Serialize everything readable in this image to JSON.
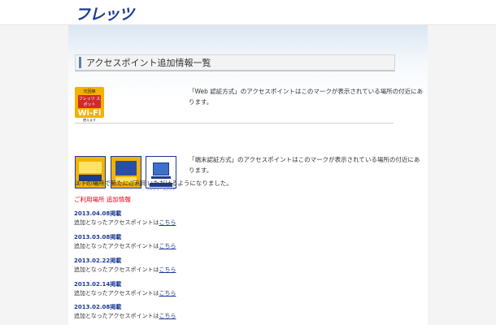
{
  "header": {
    "logo_text": "フレッツ"
  },
  "section": {
    "title": "アクセスポイント追加情報一覧"
  },
  "badges": {
    "wifi": {
      "top": "光回線",
      "mid": "フレッツ スポット",
      "big": "Wi-Fi",
      "sub": "使えます"
    },
    "marks": [
      {
        "label": "フレッツ・スポット",
        "icon": "network-sticker-icon"
      },
      {
        "label": "フレッツ・スポット",
        "icon": "laptop-sticker-icon"
      },
      {
        "label": "フレッツ・スポット",
        "icon": "pc-sticker-icon"
      }
    ]
  },
  "descriptions": {
    "web_auth": "「Web 認証方式」のアクセスポイントはこのマークが表示されている場所の付近にあります。",
    "device_auth": "「端末認証方式」のアクセスポイントはこのマークが表示されている場所の付近にあります。"
  },
  "intro": "以下の場所で新たにご利用いただけるようになりました。",
  "subhead": "ご利用場所 追加情報",
  "entries": [
    {
      "date": "2013.04.08掲載",
      "text": "追加となったアクセスポイントは",
      "link": "こちら"
    },
    {
      "date": "2013.03.08掲載",
      "text": "追加となったアクセスポイントは",
      "link": "こちら"
    },
    {
      "date": "2013.02.22掲載",
      "text": "追加となったアクセスポイントは",
      "link": "こちら"
    },
    {
      "date": "2013.02.14掲載",
      "text": "追加となったアクセスポイントは",
      "link": "こちら"
    },
    {
      "date": "2013.02.08掲載",
      "text": "追加となったアクセスポイントは",
      "link": "こちら"
    }
  ],
  "colors": {
    "brand": "#1d3a93",
    "accent": "#e60012",
    "badge": "#f3b200"
  }
}
